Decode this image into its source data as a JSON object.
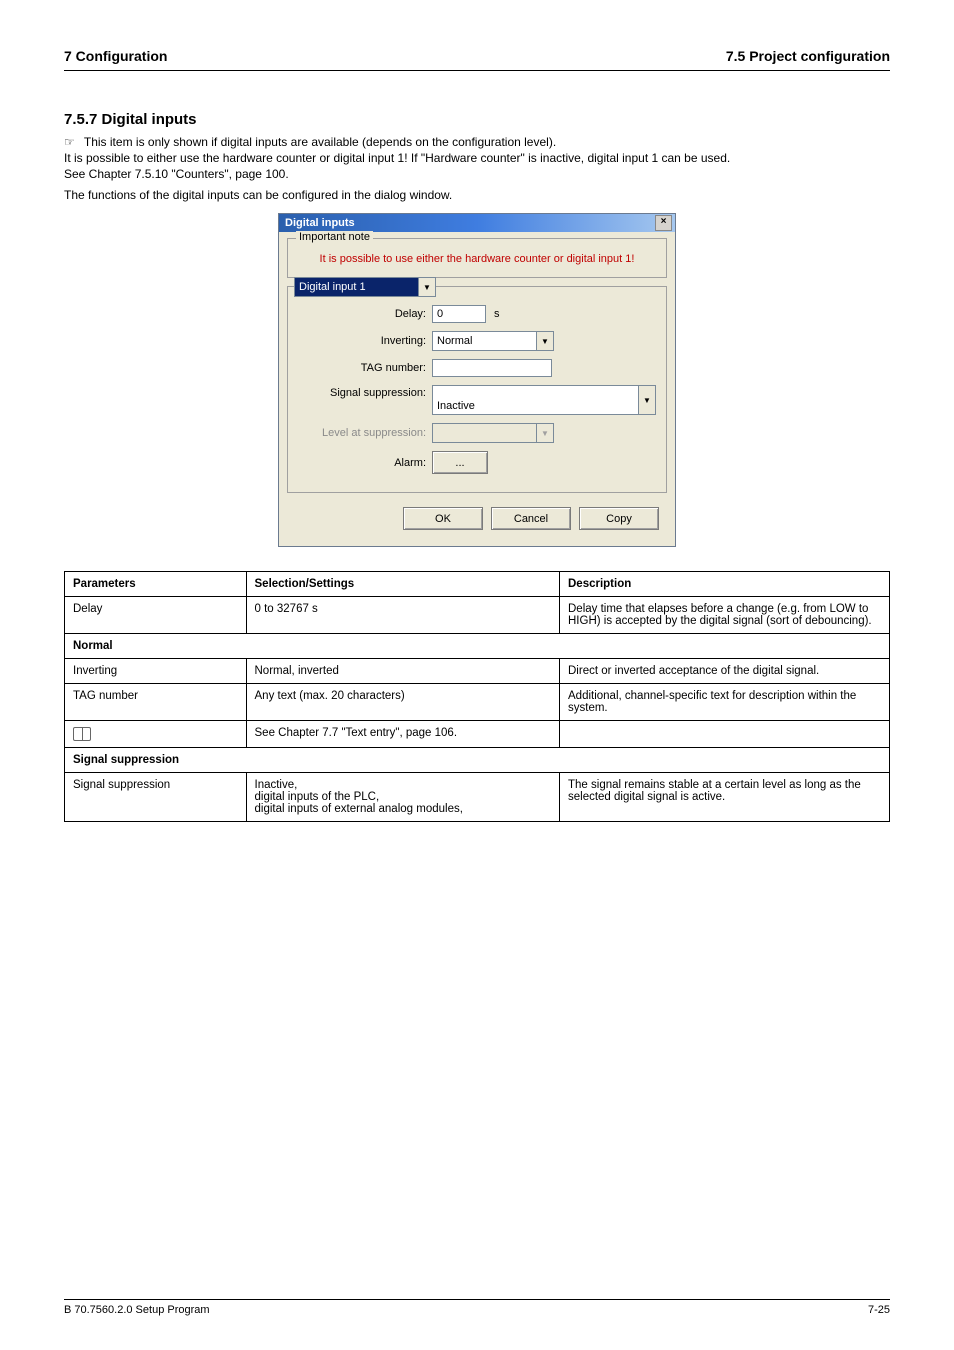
{
  "header": {
    "chapter": "7 Configuration",
    "page": "7.5 Project configuration"
  },
  "section": {
    "title": "7.5.7 Digital inputs",
    "note_symbol": "☞",
    "note_lines": [
      "This item is only shown if digital inputs are available (depends on the configuration level).",
      "It is possible to either use the hardware counter or digital input 1! If \"Hardware counter\" is inactive, digital input 1 can be used.",
      "See Chapter 7.5.10 \"Counters\", page 100."
    ],
    "intro": "The functions of the digital inputs can be configured in the dialog window."
  },
  "dialog": {
    "title": "Digital inputs",
    "note_box": {
      "label": "Important note",
      "text": "It is possible to use either the hardware counter or digital input 1!"
    },
    "input_select": "Digital input 1",
    "fields": {
      "delay_label": "Delay:",
      "delay_value": "0",
      "delay_unit": "s",
      "inverting_label": "Inverting:",
      "inverting_value": "Normal",
      "tag_label": "TAG number:",
      "tag_value": "",
      "sigsup_label": "Signal suppression:",
      "sigsup_value": "Inactive",
      "level_label": "Level at suppression:",
      "level_value": "",
      "alarm_label": "Alarm:",
      "alarm_btn": "..."
    },
    "buttons": {
      "ok": "OK",
      "cancel": "Cancel",
      "copy": "Copy"
    }
  },
  "table": {
    "header": {
      "param": "Parameters",
      "sel": "Selection/Settings",
      "desc": "Description"
    },
    "rows": [
      {
        "param": "Delay",
        "sel": "0 to 32767 s",
        "desc": "Delay time that elapses before a change (e.g. from LOW to HIGH) is accepted by the digital signal (sort of debouncing)."
      }
    ],
    "inverting_header": "Normal",
    "inverting_rows": [
      {
        "param": "Inverting",
        "sel": "Normal, inverted",
        "desc": "Direct or inverted acceptance of the digital signal."
      },
      {
        "param": "TAG number",
        "sel": "Any text (max. 20 characters)",
        "desc": "Additional, channel-specific text for description within the system."
      },
      {
        "param_html": "<span class=\"book-icon\"></span>",
        "sel": "See Chapter 7.7 \"Text entry\", page 106.",
        "desc": ""
      }
    ],
    "sigsup_header": "Signal suppression",
    "sigsup_rows": [
      {
        "param": "Signal suppression",
        "sel": "Inactive,\ndigital inputs of the PLC,\ndigital inputs of external analog modules,",
        "desc": "The signal remains stable at a certain level as long as the selected digital signal is active."
      }
    ]
  },
  "footer": {
    "left": "B 70.7560.2.0 Setup Program",
    "right": "7-25"
  }
}
